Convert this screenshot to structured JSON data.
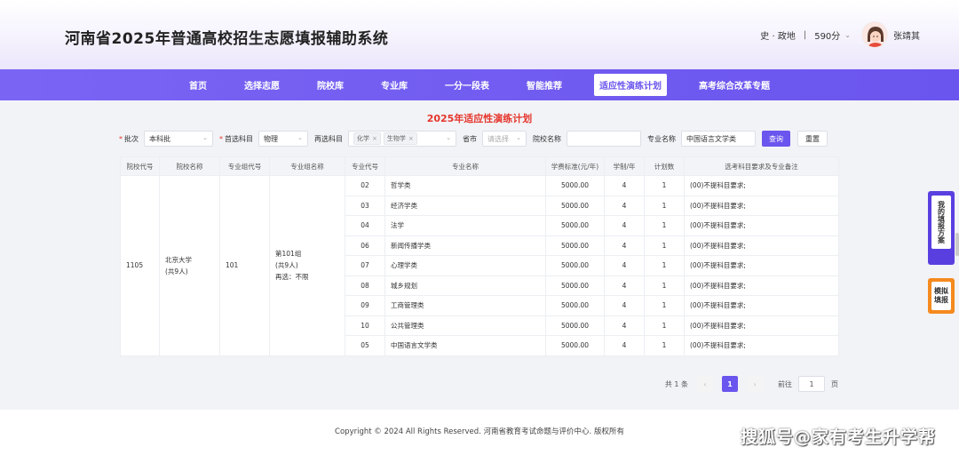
{
  "header": {
    "site_title": "河南省2025年普通高校招生志愿填报辅助系统",
    "subjects": "史 · 政地",
    "separator": "|",
    "score": "590分",
    "user_name": "张靖其"
  },
  "nav": {
    "items": [
      "首页",
      "选择志愿",
      "院校库",
      "专业库",
      "一分一段表",
      "智能推荐",
      "适应性演练计划",
      "高考综合改革专题"
    ],
    "active_index": 6
  },
  "page_heading": "2025年适应性演练计划",
  "filters": {
    "batch_label": "批次",
    "batch_value": "本科批",
    "first_subject_label": "首选科目",
    "first_subject_value": "物理",
    "second_subject_label": "再选科目",
    "second_subject_tags": [
      "化学",
      "生物学"
    ],
    "province_label": "省市",
    "province_placeholder": "请选择",
    "school_label": "院校名称",
    "school_value": "",
    "major_label": "专业名称",
    "major_value": "中国语言文学类",
    "search_button": "查询",
    "reset_button": "重置"
  },
  "table": {
    "columns": [
      "院校代号",
      "院校名称",
      "专业组代号",
      "专业组名称",
      "专业代号",
      "专业名称",
      "学费标准(元/年)",
      "学制/年",
      "计划数",
      "选考科目要求及专业备注"
    ],
    "school": {
      "code": "1105",
      "name": "北京大学",
      "count": "(共9人)",
      "group_code": "101",
      "group_name": "第101组",
      "group_count": "(共9人)",
      "group_req": "再选：不限"
    },
    "rows": [
      {
        "code": "02",
        "name": "哲学类",
        "fee": "5000.00",
        "years": "4",
        "plan": "1",
        "note": "(00)不提科目要求;"
      },
      {
        "code": "03",
        "name": "经济学类",
        "fee": "5000.00",
        "years": "4",
        "plan": "1",
        "note": "(00)不提科目要求;"
      },
      {
        "code": "04",
        "name": "法学",
        "fee": "5000.00",
        "years": "4",
        "plan": "1",
        "note": "(00)不提科目要求;"
      },
      {
        "code": "06",
        "name": "新闻传播学类",
        "fee": "5000.00",
        "years": "4",
        "plan": "1",
        "note": "(00)不提科目要求;"
      },
      {
        "code": "07",
        "name": "心理学类",
        "fee": "5000.00",
        "years": "4",
        "plan": "1",
        "note": "(00)不提科目要求;"
      },
      {
        "code": "08",
        "name": "城乡规划",
        "fee": "5000.00",
        "years": "4",
        "plan": "1",
        "note": "(00)不提科目要求;"
      },
      {
        "code": "09",
        "name": "工商管理类",
        "fee": "5000.00",
        "years": "4",
        "plan": "1",
        "note": "(00)不提科目要求;"
      },
      {
        "code": "10",
        "name": "公共管理类",
        "fee": "5000.00",
        "years": "4",
        "plan": "1",
        "note": "(00)不提科目要求;"
      },
      {
        "code": "05",
        "name": "中国语言文学类",
        "fee": "5000.00",
        "years": "4",
        "plan": "1",
        "note": "(00)不提科目要求;"
      }
    ]
  },
  "pagination": {
    "total": "共 1 条",
    "prev": "‹",
    "current": "1",
    "next": "›",
    "goto_label": "前往",
    "goto_value": "1",
    "page_unit": "页"
  },
  "footer": {
    "copyright": "Copyright © 2024 All Rights Reserved. 河南省教育考试命题与评价中心. 版权所有",
    "watermark": "搜狐号@家有考生升学帮"
  },
  "floating": {
    "my_plan": "我的填报方案",
    "mock_fill": "模拟填报"
  },
  "colors": {
    "accent": "#6a55ee",
    "heading_red": "#e5362c",
    "orange": "#f58a1f"
  }
}
